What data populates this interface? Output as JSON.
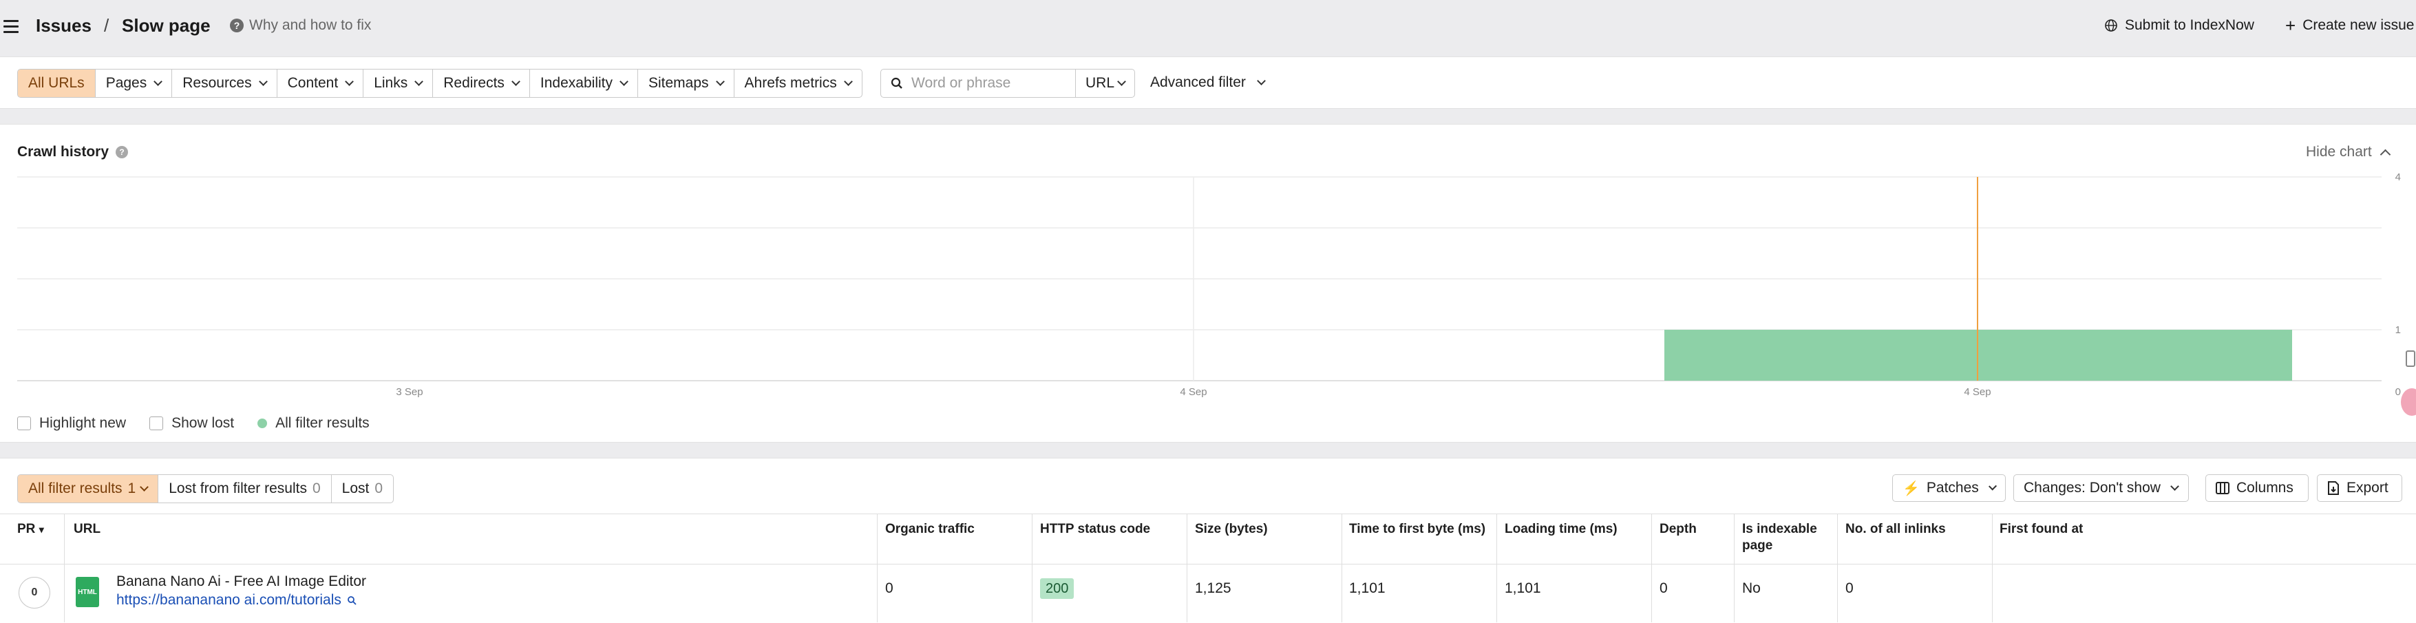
{
  "header": {
    "crumb_1": "Issues",
    "separator": "/",
    "crumb_2": "Slow page",
    "help_link": "Why and how to fix",
    "submit": "Submit to IndexNow",
    "create": "Create new issue"
  },
  "filters": {
    "items": [
      "All URLs",
      "Pages",
      "Resources",
      "Content",
      "Links",
      "Redirects",
      "Indexability",
      "Sitemaps",
      "Ahrefs metrics"
    ],
    "search_placeholder": "Word or phrase",
    "search_scope": "URL",
    "advanced": "Advanced filter"
  },
  "crawl_history": {
    "title": "Crawl history",
    "hide_chart": "Hide chart",
    "legend": {
      "highlight_new": "Highlight new",
      "show_lost": "Show lost",
      "all_results": "All filter results"
    }
  },
  "chart_data": {
    "type": "bar",
    "title": "Crawl history",
    "x_ticks": [
      "3 Sep",
      "4 Sep",
      "4 Sep"
    ],
    "y_ticks": [
      0,
      1,
      4
    ],
    "ylim": [
      0,
      4
    ],
    "series": [
      {
        "name": "All filter results",
        "values": [
          1
        ]
      }
    ],
    "grid": true,
    "colors": {
      "bar": "#8dd1a7",
      "marker": "#f0a040"
    }
  },
  "results": {
    "tabs": [
      {
        "label": "All filter results",
        "count": "1"
      },
      {
        "label": "Lost from filter results",
        "count": "0"
      },
      {
        "label": "Lost",
        "count": "0"
      }
    ],
    "patches": "Patches",
    "changes": "Changes: Don't show",
    "columns": "Columns",
    "export": "Export"
  },
  "table": {
    "headers": {
      "pr": "PR",
      "url": "URL",
      "organic": "Organic traffic",
      "status": "HTTP status code",
      "size": "Size (bytes)",
      "ttfb": "Time to first byte (ms)",
      "loading": "Loading time (ms)",
      "depth": "Depth",
      "indexable": "Is indexable page",
      "inlinks": "No. of all inlinks",
      "first_found": "First found at"
    },
    "row": {
      "pr": "0",
      "icon": "HTML",
      "title": "Banana Nano Ai - Free AI Image Editor",
      "url": "https://banananano ai.com/tutorials",
      "organic": "0",
      "status": "200",
      "size": "1,125",
      "ttfb": "1,101",
      "loading": "1,101",
      "depth": "0",
      "indexable": "No",
      "inlinks": "0"
    }
  }
}
